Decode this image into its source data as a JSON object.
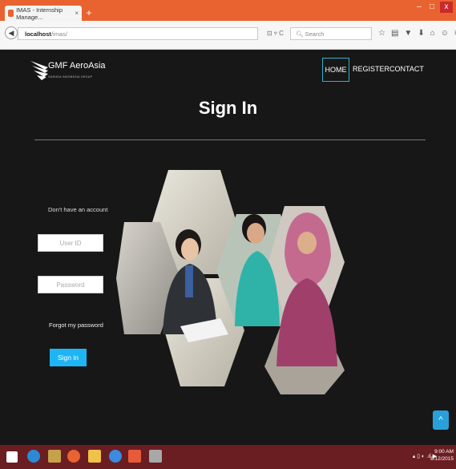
{
  "browser": {
    "tab_title": "IMAS - Internship Manage...",
    "tab_close": "×",
    "new_tab": "+",
    "url_host": "localhost",
    "url_path": "/imas/",
    "url_icons": "⊡ ▿ C",
    "search_placeholder": "Search",
    "window_controls": [
      "–",
      "□",
      "x"
    ]
  },
  "site": {
    "logo_text": "GMF AeroAsia",
    "logo_sub": "GARUDA INDONESIA GROUP",
    "menu": {
      "home": "HOME",
      "register": "REGISTER",
      "contact": "CONTACT"
    }
  },
  "signin": {
    "title": "Sign In",
    "no_account": "Don't have an account",
    "user_placeholder": "User ID",
    "password_placeholder": "Password",
    "forgot": "Forgot my password",
    "button": "Sign in",
    "totop": "^"
  },
  "taskbar": {
    "tray": "▴ ▯ ◐ .ıl ▶",
    "time": "9:00 AM",
    "date": "8/12/2015"
  },
  "colors": {
    "accent": "#1fb5f5",
    "firefox_bar": "#e8632f",
    "taskbar": "#6a1e22"
  }
}
